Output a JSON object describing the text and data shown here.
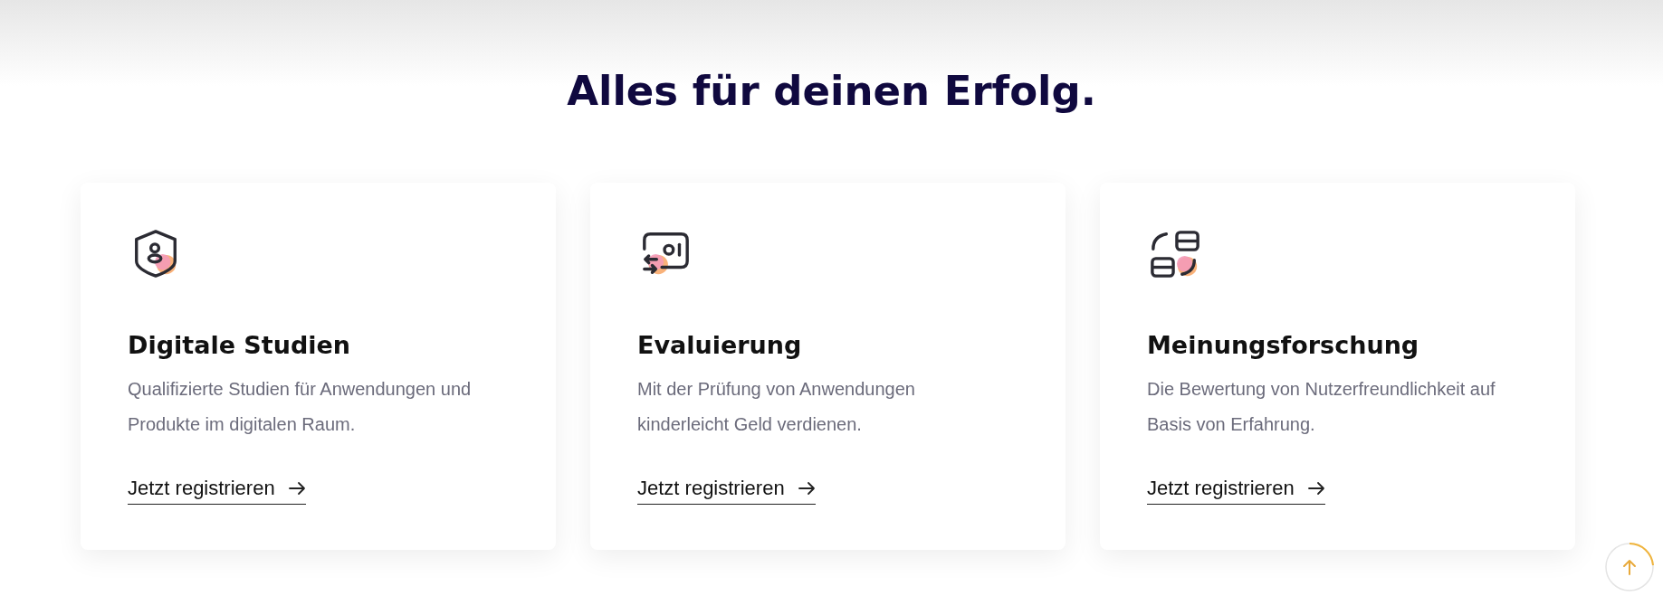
{
  "heading": "Alles für deinen Erfolg.",
  "cards": [
    {
      "title": "Digitale Studien",
      "text": "Qualifizierte Studien für Anwendungen und Produkte im digitalen Raum.",
      "link": "Jetzt registrieren"
    },
    {
      "title": "Evaluierung",
      "text": "Mit der Prüfung von Anwendungen kinderleicht Geld verdienen.",
      "link": "Jetzt registrieren"
    },
    {
      "title": "Meinungsforschung",
      "text": "Die Bewertung von Nutzerfreundlichkeit auf Basis von Erfahrung.",
      "link": "Jetzt registrieren"
    }
  ]
}
